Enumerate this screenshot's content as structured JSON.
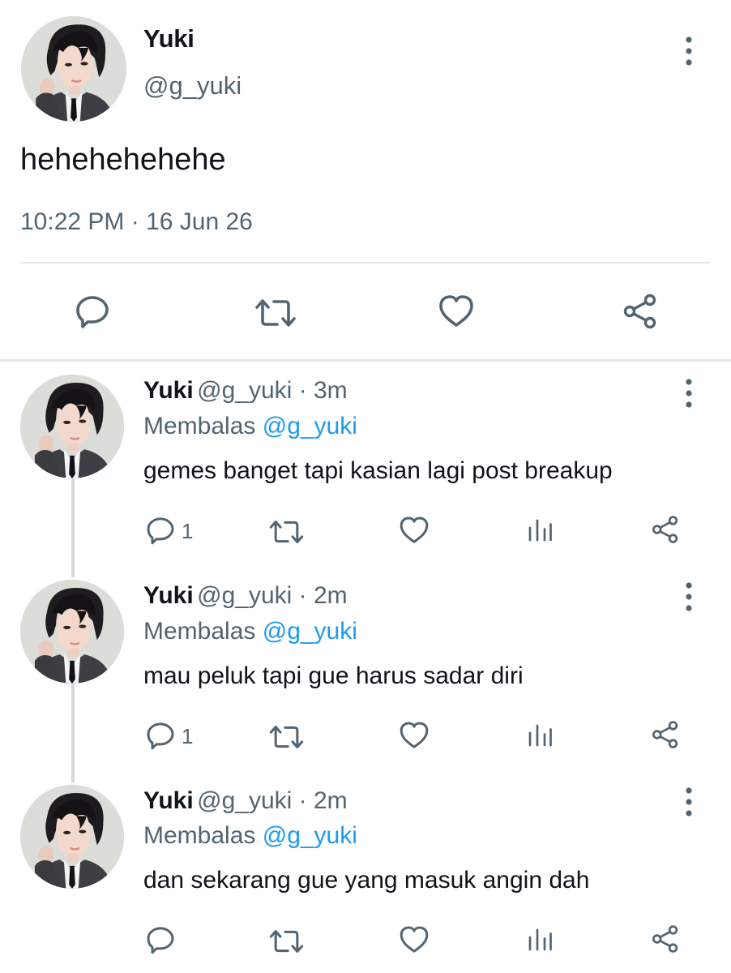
{
  "main_tweet": {
    "display_name": "Yuki",
    "handle": "@g_yuki",
    "text": "hehehehehehe",
    "timestamp": "10:22 PM · 16 Jun 26"
  },
  "replies": [
    {
      "display_name": "Yuki",
      "handle_time": "@g_yuki · 3m",
      "replying_prefix": "Membalas",
      "replying_to": "@g_yuki",
      "text": "gemes banget tapi kasian lagi post breakup",
      "reply_count": "1"
    },
    {
      "display_name": "Yuki",
      "handle_time": "@g_yuki · 2m",
      "replying_prefix": "Membalas",
      "replying_to": "@g_yuki",
      "text": "mau peluk tapi gue harus sadar diri",
      "reply_count": "1"
    },
    {
      "display_name": "Yuki",
      "handle_time": "@g_yuki · 2m",
      "replying_prefix": "Membalas",
      "replying_to": "@g_yuki",
      "text": "dan sekarang gue yang masuk angin dah",
      "reply_count": ""
    }
  ],
  "icons": {
    "reply": "comment-bubble-icon",
    "retweet": "retweet-icon",
    "like": "heart-icon",
    "share": "share-icon",
    "analytics": "analytics-icon",
    "more": "more-vertical-icon"
  },
  "colors": {
    "text": "#0f1419",
    "secondary": "#536471",
    "mention": "#1d9bf0",
    "divider": "#e7e9ea"
  }
}
